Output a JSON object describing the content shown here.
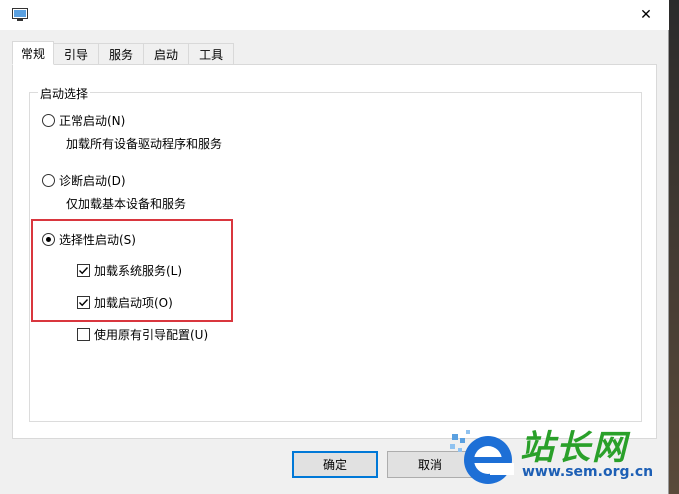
{
  "titlebar": {
    "close_symbol": "✕"
  },
  "tabs": [
    {
      "label": "常规",
      "active": true
    },
    {
      "label": "引导",
      "active": false
    },
    {
      "label": "服务",
      "active": false
    },
    {
      "label": "启动",
      "active": false
    },
    {
      "label": "工具",
      "active": false
    }
  ],
  "startup_group": {
    "legend": "启动选择",
    "normal": {
      "label": "正常启动(N)",
      "description": "加载所有设备驱动程序和服务",
      "selected": false
    },
    "diagnostic": {
      "label": "诊断启动(D)",
      "description": "仅加载基本设备和服务",
      "selected": false
    },
    "selective": {
      "label": "选择性启动(S)",
      "selected": true,
      "load_system_services": {
        "label": "加载系统服务(L)",
        "checked": true
      },
      "load_startup_items": {
        "label": "加载启动项(O)",
        "checked": true
      },
      "use_original_boot": {
        "label": "使用原有引导配置(U)",
        "checked": false
      }
    }
  },
  "buttons": {
    "ok": "确定",
    "cancel": "取消"
  },
  "watermark": {
    "title": "站长网",
    "url": "www.sem.org.cn"
  },
  "colors": {
    "highlight": "#d9363e",
    "accent": "#0078d7"
  }
}
